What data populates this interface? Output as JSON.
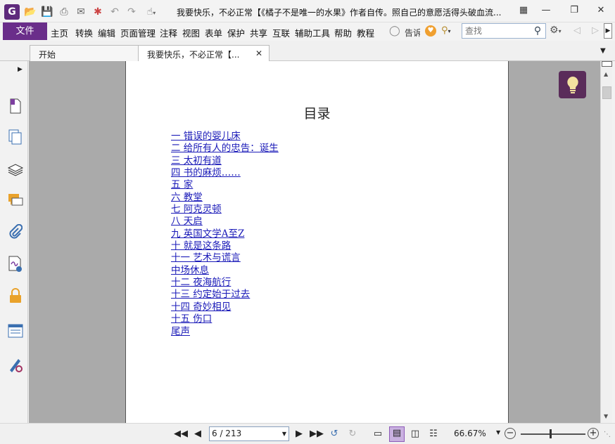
{
  "window": {
    "app_logo": "G",
    "title": "我要快乐，不必正常【《橘子不是唯一的水果》作者自传。照自己的意愿活得头破血流..."
  },
  "menu": {
    "file": "文件",
    "items": [
      "主页",
      "转换",
      "编辑",
      "页面管理",
      "注释",
      "视图",
      "表单",
      "保护",
      "共享",
      "互联",
      "辅助工具",
      "帮助",
      "教程"
    ],
    "tell_me": "告诉",
    "search_placeholder": "查找"
  },
  "tabs": [
    {
      "label": "开始"
    },
    {
      "label": "我要快乐，不必正常【..."
    }
  ],
  "document": {
    "toc_title": "目录",
    "toc_items": [
      "一 错误的婴儿床",
      "二 给所有人的忠告：诞生",
      "三 太初有道",
      "四 书的麻烦……",
      "五 家",
      "六 教堂",
      "七 阿克灵顿",
      "八 天启",
      "九 英国文学A至Z",
      "十 就是这条路",
      "十一 艺术与谎言",
      "中场休息",
      "十二 夜海航行",
      "十三 约定始于过去",
      "十四 奇妙相见",
      "十五 伤口",
      "尾声"
    ]
  },
  "status": {
    "page_indicator": "6 / 213",
    "zoom": "66.67%",
    "zoom_level_fraction": 0.45
  }
}
